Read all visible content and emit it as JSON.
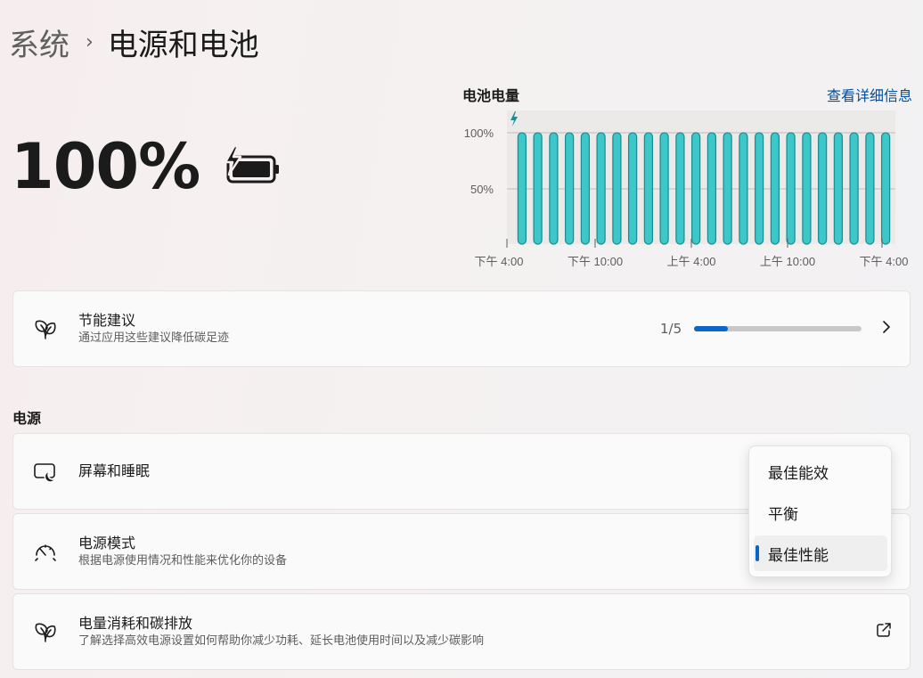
{
  "breadcrumb": {
    "parent": "系统",
    "separator": "›",
    "current": "电源和电池"
  },
  "battery": {
    "percent_text": "100%",
    "icon": "battery-charging-icon",
    "level": 100
  },
  "chart": {
    "title": "电池电量",
    "link": "查看详细信息",
    "icon": "lightning-icon",
    "accent": "#3ec7c9"
  },
  "chart_data": {
    "type": "bar",
    "title": "电池电量",
    "ylabel": "",
    "xlabel": "",
    "ylim": [
      0,
      100
    ],
    "yticks": [
      "100%",
      "50%"
    ],
    "xticks": [
      "下午 4:00",
      "下午 10:00",
      "上午 4:00",
      "上午 10:00",
      "下午 4:00"
    ],
    "values": [
      100,
      100,
      100,
      100,
      100,
      100,
      100,
      100,
      100,
      100,
      100,
      100,
      100,
      100,
      100,
      100,
      100,
      100,
      100,
      100,
      100,
      100,
      100,
      100
    ],
    "grid": true,
    "charging_indicator": true
  },
  "energy_card": {
    "title": "节能建议",
    "subtitle": "通过应用这些建议降低碳足迹",
    "progress_text": "1/5",
    "progress": 0.2,
    "icon": "leaf-icon"
  },
  "power_section": {
    "label": "电源"
  },
  "screen_sleep": {
    "title": "屏幕和睡眠",
    "icon": "screen-sleep-icon"
  },
  "power_mode": {
    "title": "电源模式",
    "subtitle": "根据电源使用情况和性能来优化你的设备",
    "icon": "speedometer-icon",
    "options": [
      "最佳能效",
      "平衡",
      "最佳性能"
    ],
    "selected": "最佳性能"
  },
  "carbon_card": {
    "title": "电量消耗和碳排放",
    "subtitle": "了解选择高效电源设置如何帮助你减少功耗、延长电池使用时间以及减少碳影响",
    "icon": "leaf-icon",
    "link_icon": "external-link-icon"
  },
  "colors": {
    "accent": "#0a67c8",
    "link": "#004e9a",
    "bar_fill": "#3ec7c9",
    "bar_stroke": "#1c8f96"
  }
}
